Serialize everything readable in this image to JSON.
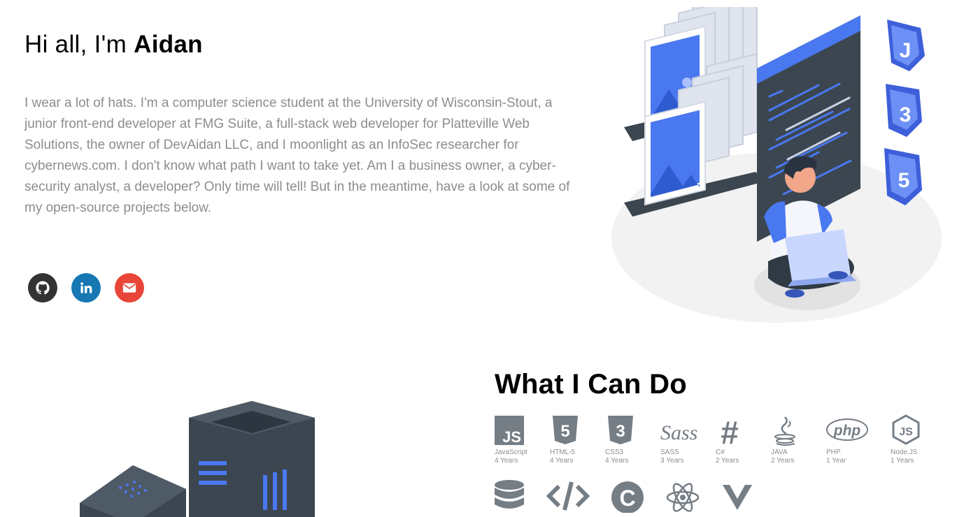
{
  "intro": {
    "greeting_prefix": "Hi all, I'm",
    "greeting_name": "Aidan",
    "bio": "I wear a lot of hats. I'm a computer science student at the University of Wisconsin-Stout, a junior front-end developer at FMG Suite, a full-stack web developer for Platteville Web Solutions, the owner of DevAidan LLC, and I moonlight as an InfoSec researcher for cybernews.com. I don't know what path I want to take yet. Am I a business owner, a cyber-security analyst, a developer? Only time will tell! But in the meantime, have a look at some of my open-source projects below."
  },
  "socials": [
    {
      "icon": "github-icon",
      "color": "#333333"
    },
    {
      "icon": "linkedin-icon",
      "color": "#1677b3"
    },
    {
      "icon": "envelope-icon",
      "color": "#e84538"
    }
  ],
  "skills": {
    "title": "What I Can Do",
    "items": [
      {
        "name": "JavaScript",
        "years": "4 Years",
        "icon": "javascript-icon"
      },
      {
        "name": "HTML-5",
        "years": "4 Years",
        "icon": "html5-icon"
      },
      {
        "name": "CSS3",
        "years": "4 Years",
        "icon": "css3-icon"
      },
      {
        "name": "SASS",
        "years": "3 Years",
        "icon": "sass-icon"
      },
      {
        "name": "C#",
        "years": "2 Years",
        "icon": "csharp-icon"
      },
      {
        "name": "JAVA",
        "years": "2 Years",
        "icon": "java-icon"
      },
      {
        "name": "PHP",
        "years": "1 Year",
        "icon": "php-icon"
      },
      {
        "name": "Node.JS",
        "years": "1 Years",
        "icon": "nodejs-icon"
      }
    ],
    "second_row_icons": [
      "database-icon",
      "code-icon",
      "c-language-icon",
      "react-icon",
      "vue-icon"
    ]
  },
  "colors": {
    "accent_blue": "#3d6ef2",
    "dark_slate": "#3b4650",
    "text_gray": "#8d8d8d",
    "icon_gray": "#757d85"
  }
}
